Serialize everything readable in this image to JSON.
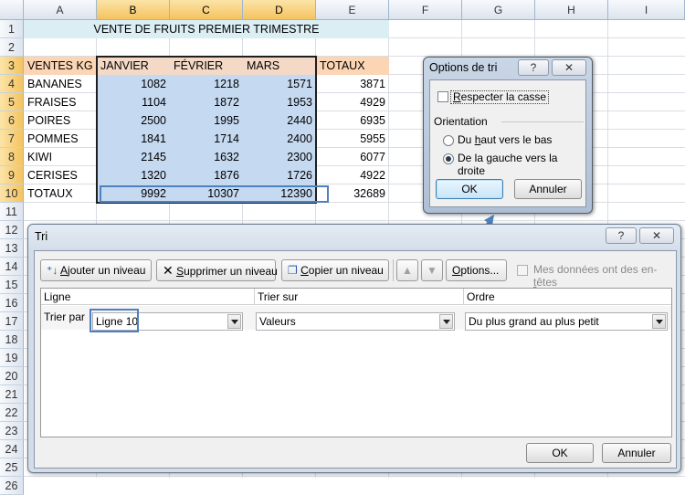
{
  "sheet": {
    "columns": [
      "A",
      "B",
      "C",
      "D",
      "E",
      "F",
      "G",
      "H",
      "I"
    ],
    "rows": [
      "1",
      "2",
      "3",
      "4",
      "5",
      "6",
      "7",
      "8",
      "9",
      "10",
      "11",
      "12",
      "13",
      "14",
      "15",
      "16",
      "17",
      "18",
      "19",
      "20",
      "21",
      "22",
      "23",
      "24",
      "25",
      "26"
    ],
    "title": "VENTE DE FRUITS PREMIER TRIMESTRE",
    "headers": {
      "label": "VENTES KG",
      "months": [
        "JANVIER",
        "FÉVRIER",
        "MARS"
      ],
      "total": "TOTAUX"
    },
    "data": [
      {
        "fruit": "BANANES",
        "v": [
          "1082",
          "1218",
          "1571"
        ],
        "total": "3871"
      },
      {
        "fruit": "FRAISES",
        "v": [
          "1104",
          "1872",
          "1953"
        ],
        "total": "4929"
      },
      {
        "fruit": "POIRES",
        "v": [
          "2500",
          "1995",
          "2440"
        ],
        "total": "6935"
      },
      {
        "fruit": "POMMES",
        "v": [
          "1841",
          "1714",
          "2400"
        ],
        "total": "5955"
      },
      {
        "fruit": "KIWI",
        "v": [
          "2145",
          "1632",
          "2300"
        ],
        "total": "6077"
      },
      {
        "fruit": "CERISES",
        "v": [
          "1320",
          "1876",
          "1726"
        ],
        "total": "4922"
      }
    ],
    "totals": {
      "label": "TOTAUX",
      "v": [
        "9992",
        "10307",
        "12390"
      ],
      "grand": "32689"
    },
    "colors": {
      "title_bg": "#daeef3",
      "header_bg": "#fcd5b4",
      "selection_bg": "#c5d9f1",
      "highlight": "#4f81bd"
    }
  },
  "options_dialog": {
    "title": "Options de tri",
    "help": "?",
    "case_pre": "",
    "case_ul": "R",
    "case_post": "especter la casse",
    "orientation_label": "Orientation",
    "top_pre": "Du ",
    "top_ul": "h",
    "top_post": "aut vers le bas",
    "left_pre": "De la ",
    "left_ul": "g",
    "left_post": "auche vers la droite",
    "ok": "OK",
    "cancel": "Annuler"
  },
  "sort_dialog": {
    "title": "Tri",
    "help": "?",
    "add_ul": "A",
    "add_post": "jouter un niveau",
    "delete_ul": "S",
    "delete_post": "upprimer un niveau",
    "copy_ul": "C",
    "copy_post": "opier un niveau",
    "options_pre": "",
    "options_ul": "O",
    "options_post": "ptions...",
    "headers_pre": "Mes données ont des en-",
    "headers_ul": "t",
    "headers_post": "êtes",
    "col_line": "Ligne",
    "col_sort_on": "Trier sur",
    "col_order": "Ordre",
    "sort_by": "Trier par",
    "line_value": "Ligne 10",
    "sort_on_value": "Valeurs",
    "order_value": "Du plus grand au plus petit",
    "ok": "OK",
    "cancel": "Annuler"
  }
}
